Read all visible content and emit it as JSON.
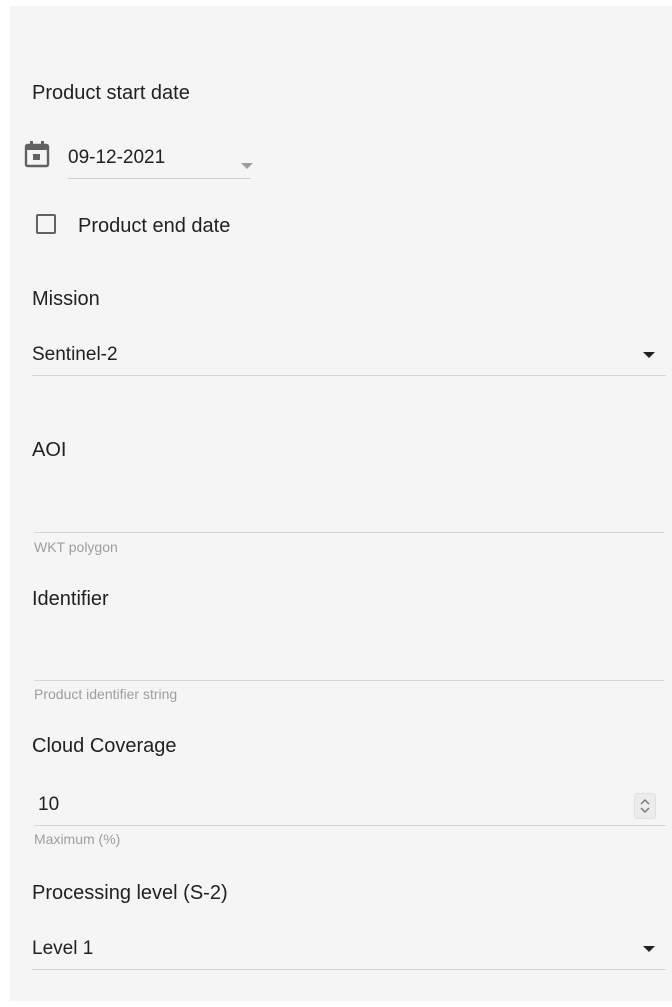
{
  "form": {
    "start_date": {
      "label": "Product start date",
      "value": "09-12-2021"
    },
    "end_date": {
      "label": "Product end date",
      "checked": false
    },
    "mission": {
      "label": "Mission",
      "value": "Sentinel-2"
    },
    "aoi": {
      "label": "AOI",
      "value": "",
      "hint": "WKT polygon"
    },
    "identifier": {
      "label": "Identifier",
      "value": "",
      "hint": "Product identifier string"
    },
    "cloud_coverage": {
      "label": "Cloud Coverage",
      "value": "10",
      "hint": "Maximum (%)"
    },
    "processing_level": {
      "label": "Processing level (S-2)",
      "value": "Level 1"
    }
  },
  "icons": {
    "date": "calendar-icon",
    "date_dropdown": "caret-down-icon",
    "select_dropdown": "caret-down-icon",
    "number_spinner": "spinner-arrows-icon"
  }
}
